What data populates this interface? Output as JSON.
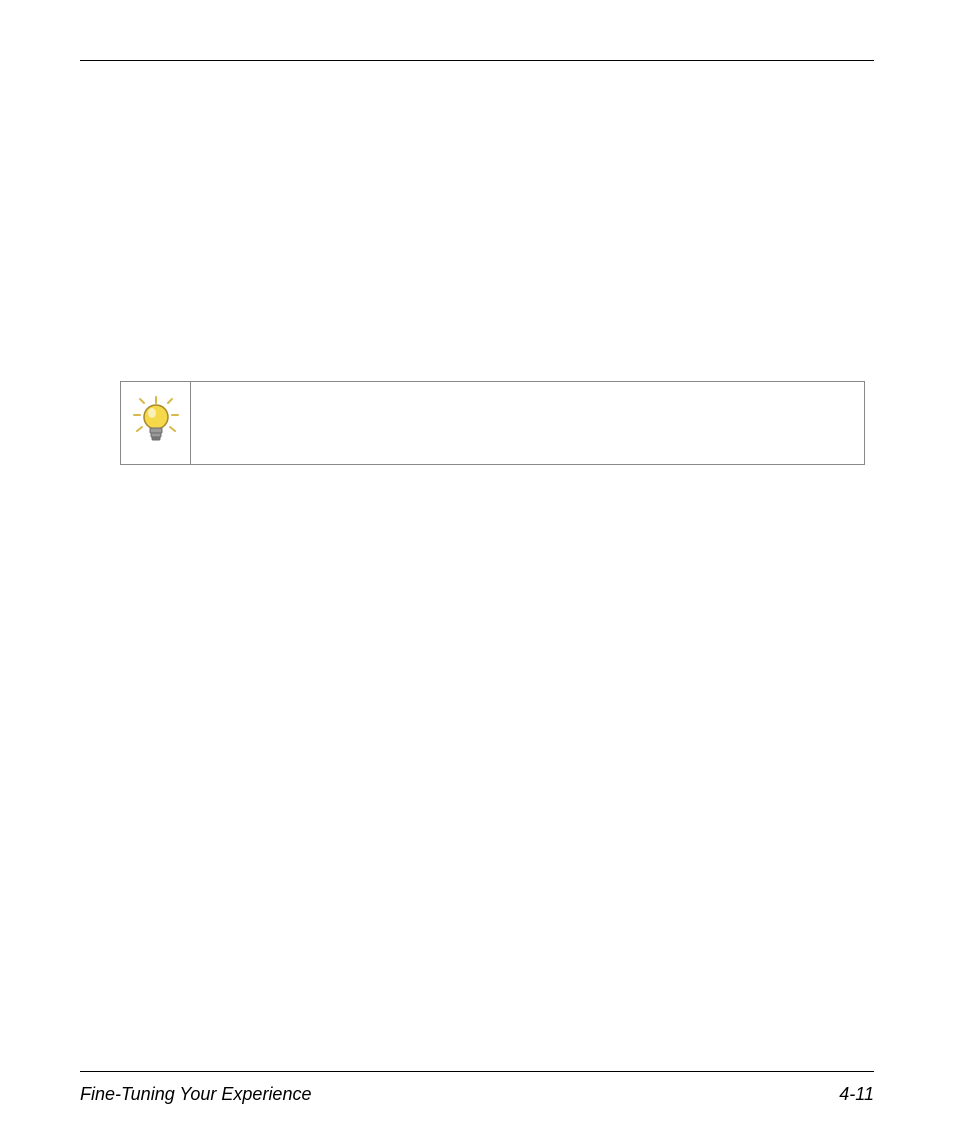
{
  "footer": {
    "section_title": "Fine-Tuning Your Experience",
    "page_number": "4-11"
  },
  "callout": {
    "icon_name": "lightbulb-tip-icon",
    "content": ""
  }
}
